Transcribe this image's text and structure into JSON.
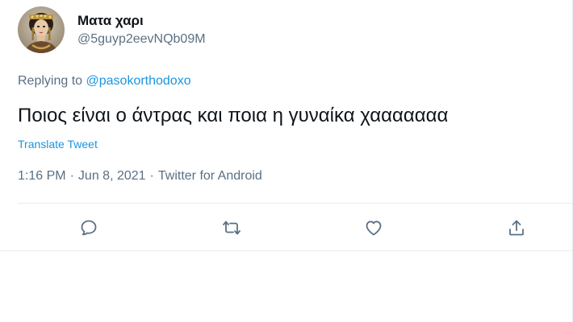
{
  "user": {
    "display_name": "Ματα χαρι",
    "handle": "@5guyp2eevNQb09M",
    "avatar_icon": "avatar-image"
  },
  "reply": {
    "prefix": "Replying to",
    "mention": "@pasokorthodoxo"
  },
  "tweet": {
    "text": "Ποιος είναι ο άντρας και ποια η γυναίκα χααααααα",
    "translate_label": "Translate Tweet"
  },
  "meta": {
    "time": "1:16 PM",
    "separator": "·",
    "date": "Jun 8, 2021",
    "source": "Twitter for Android"
  },
  "actions": [
    {
      "icon": "reply-icon"
    },
    {
      "icon": "retweet-icon"
    },
    {
      "icon": "like-icon"
    },
    {
      "icon": "share-icon"
    }
  ],
  "colors": {
    "text": "#0f1419",
    "secondary": "#5b7083",
    "link": "#1b95e0",
    "divider": "#e6ecf0",
    "icon": "#5b7083"
  }
}
